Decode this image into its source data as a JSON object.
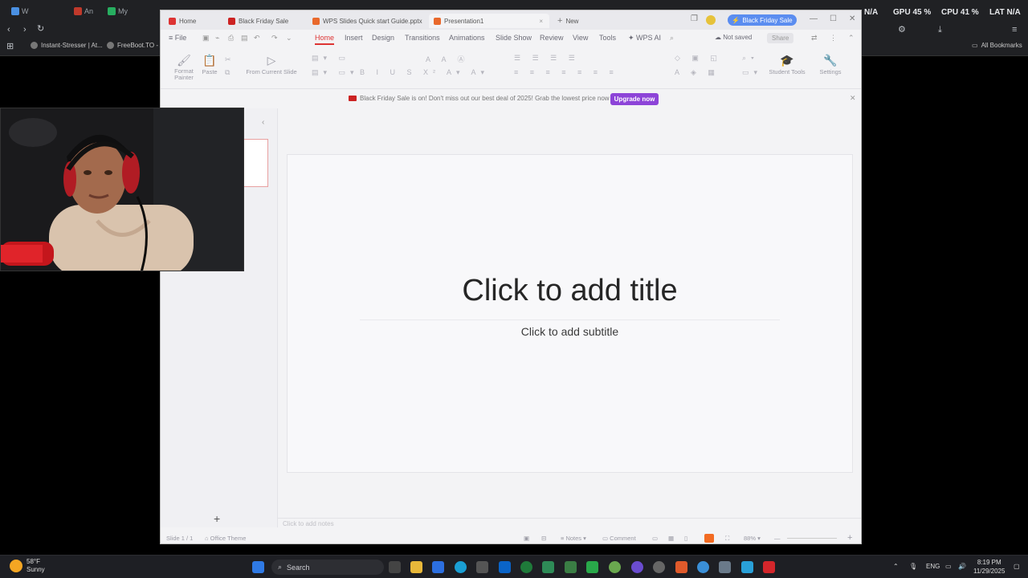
{
  "browser": {
    "tabs": [
      {
        "label": "W",
        "color": "#4a90e2"
      },
      {
        "label": "An",
        "color": "#c0392b"
      },
      {
        "label": "My",
        "color": "#27ae60"
      }
    ],
    "stats": {
      "gpu": "GPU 45 %",
      "cpu": "CPU 41 %",
      "lat": "LAT N/A",
      "na": "N/A"
    },
    "bookmarks": [
      {
        "label": "Instant-Stresser | At..."
      },
      {
        "label": "FreeBoot.TO - A"
      }
    ],
    "all_bookmarks": "All Bookmarks"
  },
  "wps": {
    "tabs": [
      {
        "label": "Home",
        "color": "#d33"
      },
      {
        "label": "Black Friday Sale",
        "color": "#c22"
      },
      {
        "label": "WPS Slides Quick start Guide.pptx",
        "color": "#e9692c"
      },
      {
        "label": "Presentation1",
        "color": "#e9692c"
      },
      {
        "label": "New",
        "color": ""
      }
    ],
    "black_friday_button": "Black Friday Sale",
    "menu": {
      "file": "File",
      "items": [
        "Home",
        "Insert",
        "Design",
        "Transitions",
        "Animations",
        "Slide Show",
        "Review",
        "View",
        "Tools",
        "WPS AI"
      ],
      "not_saved": "Not saved",
      "share": "Share"
    },
    "ribbon": {
      "format_painter": "Format Painter",
      "paste": "Paste",
      "from_current_slide": "From Current Slide",
      "student_tools": "Student Tools",
      "settings": "Settings"
    },
    "banner": {
      "text": "Black Friday Sale is on! Don't miss out our best deal of 2025! Grab the lowest price now →",
      "upgrade": "Upgrade now"
    },
    "slide": {
      "title": "Click to add title",
      "subtitle": "Click to add subtitle"
    },
    "notes_placeholder": "Click to add notes",
    "status": {
      "slide": "Slide 1 / 1",
      "theme": "Office Theme",
      "notes": "Notes",
      "comment": "Comment",
      "zoom": "88%"
    }
  },
  "taskbar": {
    "weather_temp": "58°F",
    "weather_desc": "Sunny",
    "search": "Search",
    "lang": "ENG",
    "time": "8:19 PM",
    "date": "11/29/2025"
  }
}
